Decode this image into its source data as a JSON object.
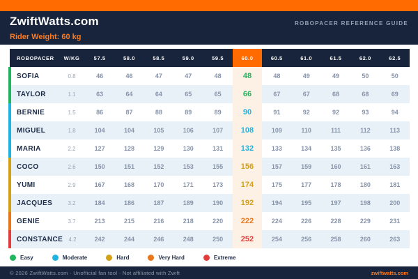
{
  "header": {
    "logo": "ZwiftWatts.com",
    "subtitle": "Rider Weight: 60 kg",
    "right_label": "ROBOPACER REFERENCE GUIDE"
  },
  "colors": {
    "accent_orange": "#ff6b00",
    "navy": "#17243b",
    "highlight_cell_bg": "#fdf0e5",
    "alt_row_bg": "#e8f1f8"
  },
  "zone_colors": {
    "easy": "#22b55e",
    "moderate": "#21b3e0",
    "hard": "#d3a118",
    "very-hard": "#e8761b",
    "extreme": "#e23d3d"
  },
  "table": {
    "name_header": "ROBOPACER",
    "wkg_header": "W/KG",
    "weight_columns": [
      "57.5",
      "58.0",
      "58.5",
      "59.0",
      "59.5",
      "60.0",
      "60.5",
      "61.0",
      "61.5",
      "62.0",
      "62.5"
    ],
    "highlight_column": "60.0",
    "highlight_index": 5,
    "rows": [
      {
        "name": "SOFIA",
        "wkg": "0.8",
        "zone": "easy",
        "values": [
          46,
          46,
          47,
          47,
          48,
          48,
          48,
          49,
          49,
          50,
          50
        ]
      },
      {
        "name": "TAYLOR",
        "wkg": "1.1",
        "zone": "easy",
        "values": [
          63,
          64,
          64,
          65,
          65,
          66,
          67,
          67,
          68,
          68,
          69
        ]
      },
      {
        "name": "BERNIE",
        "wkg": "1.5",
        "zone": "moderate",
        "values": [
          86,
          87,
          88,
          89,
          89,
          90,
          91,
          92,
          92,
          93,
          94
        ]
      },
      {
        "name": "MIGUEL",
        "wkg": "1.8",
        "zone": "moderate",
        "values": [
          104,
          104,
          105,
          106,
          107,
          108,
          109,
          110,
          111,
          112,
          113
        ]
      },
      {
        "name": "MARIA",
        "wkg": "2.2",
        "zone": "moderate",
        "values": [
          127,
          128,
          129,
          130,
          131,
          132,
          133,
          134,
          135,
          136,
          138
        ]
      },
      {
        "name": "COCO",
        "wkg": "2.6",
        "zone": "hard",
        "values": [
          150,
          151,
          152,
          153,
          155,
          156,
          157,
          159,
          160,
          161,
          163
        ]
      },
      {
        "name": "YUMI",
        "wkg": "2.9",
        "zone": "hard",
        "values": [
          167,
          168,
          170,
          171,
          173,
          174,
          175,
          177,
          178,
          180,
          181
        ]
      },
      {
        "name": "JACQUES",
        "wkg": "3.2",
        "zone": "hard",
        "values": [
          184,
          186,
          187,
          189,
          190,
          192,
          194,
          195,
          197,
          198,
          200
        ]
      },
      {
        "name": "GENIE",
        "wkg": "3.7",
        "zone": "very-hard",
        "values": [
          213,
          215,
          216,
          218,
          220,
          222,
          224,
          226,
          228,
          229,
          231
        ]
      },
      {
        "name": "CONSTANCE",
        "wkg": "4.2",
        "zone": "extreme",
        "values": [
          242,
          244,
          246,
          248,
          250,
          252,
          254,
          256,
          258,
          260,
          263
        ]
      }
    ]
  },
  "legend": {
    "items": [
      {
        "label": "Easy",
        "zone": "easy"
      },
      {
        "label": "Moderate",
        "zone": "moderate"
      },
      {
        "label": "Hard",
        "zone": "hard"
      },
      {
        "label": "Very Hard",
        "zone": "very-hard"
      },
      {
        "label": "Extreme",
        "zone": "extreme"
      }
    ]
  },
  "footer": {
    "left": "© 2026 ZwiftWatts.com  ·  Unofficial fan tool  ·  Not affiliated with Zwift",
    "right": "zwiftwatts.com"
  }
}
